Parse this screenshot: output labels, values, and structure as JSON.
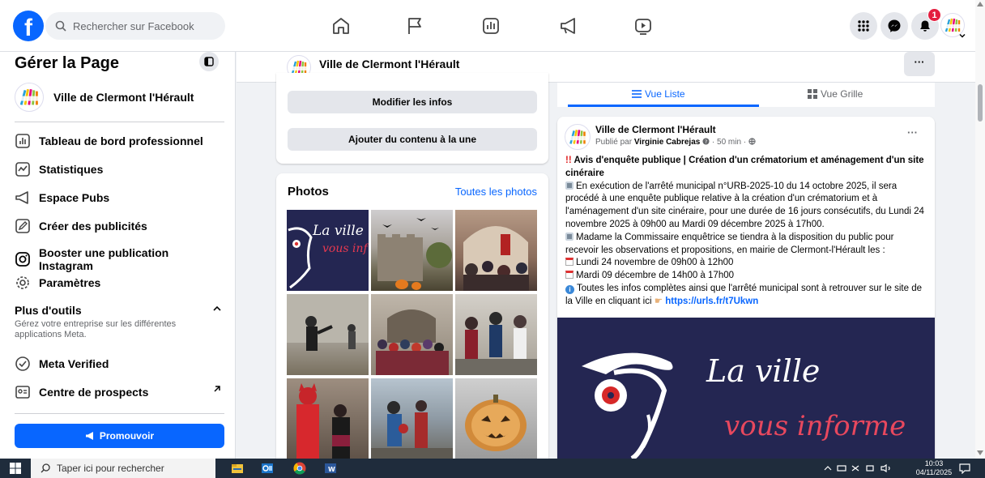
{
  "topbar": {
    "logo": "f",
    "search_placeholder": "Rechercher sur Facebook",
    "notification_count": "1",
    "icons": [
      "home-icon",
      "flag-icon",
      "dashboard-icon",
      "megaphone-icon",
      "video-icon",
      "menu-grid-icon",
      "messenger-icon",
      "bell-icon",
      "avatar"
    ]
  },
  "sidebar": {
    "title": "Gérer la Page",
    "page_name": "Ville de Clermont l'Hérault",
    "items": [
      {
        "label": "Tableau de bord professionnel",
        "icon": "dashboard-icon"
      },
      {
        "label": "Statistiques",
        "icon": "statistics-icon"
      },
      {
        "label": "Espace Pubs",
        "icon": "megaphone-icon"
      },
      {
        "label": "Créer des publicités",
        "icon": "pencil-icon"
      },
      {
        "label": "Booster une publication Instagram",
        "icon": "instagram-icon"
      },
      {
        "label": "Paramètres",
        "icon": "gear-icon"
      }
    ],
    "section_title": "Plus d'outils",
    "section_desc": "Gérez votre entreprise sur les différentes applications Meta.",
    "tools": [
      {
        "label": "Meta Verified",
        "icon": "verified-icon"
      },
      {
        "label": "Centre de prospects",
        "icon": "leads-icon"
      }
    ],
    "promote_label": "Promouvoir"
  },
  "pagebar": {
    "name": "Ville de Clermont l'Hérault",
    "more": "···"
  },
  "actions": {
    "edit_info": "Modifier les infos",
    "add_featured": "Ajouter du contenu à la une"
  },
  "photos": {
    "title": "Photos",
    "see_all": "Toutes les photos",
    "tile_text_1": "La ville",
    "tile_text_2": "vous inf"
  },
  "tabs": {
    "list": "Vue Liste",
    "grid": "Vue Grille"
  },
  "post": {
    "author": "Ville de Clermont l'Hérault",
    "published_by_prefix": "Publié par",
    "published_by": "Virginie Cabrejas",
    "time": "· 50 min ·",
    "more": "···",
    "title_marker": "!!",
    "title": "Avis d'enquête publique | Création d'un crématorium et aménagement d'un site cinéraire",
    "paragraph1": "En exécution de l'arrêté municipal n°URB-2025-10 du 14 octobre 2025, il sera procédé à une enquête publique relative à la création d'un crématorium et à l'aménagement d'un site cinéraire, pour une durée de 16 jours consécutifs, du Lundi 24 novembre 2025 à 09h00 au Mardi 09 décembre 2025 à 17h00.",
    "paragraph2": "Madame la Commissaire enquêtrice se tiendra à la disposition du public pour recevoir les observations et propositions, en mairie de Clermont-l'Hérault les :",
    "date1": "Lundi 24 novembre de 09h00 à 12h00",
    "date2": "Mardi 09 décembre de 14h00 à 17h00",
    "paragraph3": "Toutes les infos complètes ainsi que l'arrêté municipal sont à retrouver sur le site de la Ville en cliquant ici",
    "link": "https://urls.fr/t7Ukwn",
    "image_text_1": "La ville",
    "image_text_2": "vous informe"
  },
  "taskbar": {
    "search_placeholder": "Taper ici pour rechercher",
    "time": "10:03",
    "date": "04/11/2025"
  },
  "colors": {
    "brand": "#0866ff",
    "badge": "#e41e3f",
    "poster_bg": "#242652",
    "taskbar": "#1f2c3c"
  }
}
